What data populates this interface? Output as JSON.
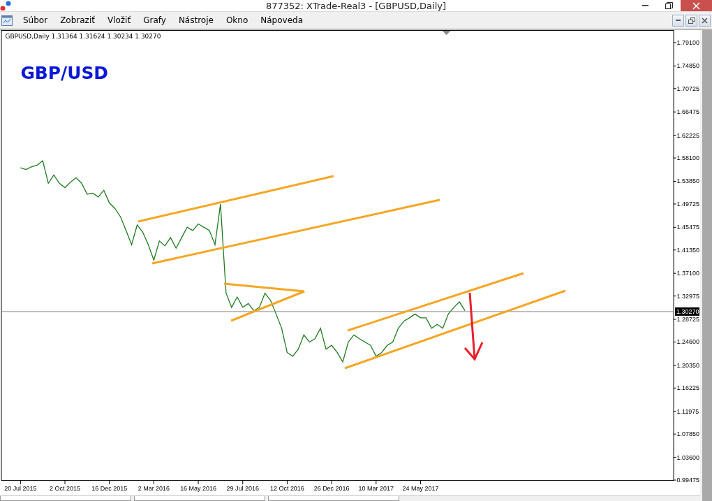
{
  "window": {
    "title": "877352: XTrade-Real3 - [GBPUSD,Daily]"
  },
  "menu": [
    {
      "label": "Súbor"
    },
    {
      "label": "Zobraziť"
    },
    {
      "label": "Vložiť"
    },
    {
      "label": "Grafy"
    },
    {
      "label": "Nástroje"
    },
    {
      "label": "Okno"
    },
    {
      "label": "Nápoveda"
    }
  ],
  "chart": {
    "header": "GBPUSD,Daily  1.31364 1.31624 1.30234 1.30270",
    "label": "GBP/USD",
    "current_price": "1.30270",
    "chart_data": {
      "type": "line",
      "ylim": [
        0.99475,
        1.81
      ],
      "categories": [
        null,
        null,
        null,
        "20 Jul 2015",
        null,
        null,
        null,
        null,
        null,
        null,
        null,
        "2 Oct 2015",
        null,
        null,
        null,
        null,
        null,
        null,
        null,
        "16 Dec 2015",
        null,
        null,
        null,
        null,
        null,
        null,
        null,
        "2 Mar 2016",
        null,
        null,
        null,
        null,
        null,
        null,
        null,
        "16 May 2016",
        null,
        null,
        null,
        null,
        null,
        null,
        null,
        "29 Jul 2016",
        null,
        null,
        null,
        null,
        null,
        null,
        null,
        "12 Oct 2016",
        null,
        null,
        null,
        null,
        null,
        null,
        null,
        "26 Dec 2016",
        null,
        null,
        null,
        null,
        null,
        null,
        null,
        "10 Mar 2017",
        null,
        null,
        null,
        null,
        null,
        null,
        null,
        "24 May 2017",
        null,
        null,
        null,
        null,
        null,
        null,
        null,
        null,
        null,
        null,
        null,
        null,
        null,
        null,
        null,
        null,
        null,
        null,
        null,
        null,
        null,
        null,
        null,
        null,
        null,
        null,
        null,
        null,
        null,
        null,
        null,
        null,
        null,
        null,
        null,
        null,
        null,
        null,
        null,
        null,
        null,
        null,
        null,
        null,
        null
      ],
      "series": [
        {
          "color": "#1f7a1f",
          "values": [
            null,
            null,
            null,
            1.563,
            1.56,
            1.565,
            1.568,
            1.576,
            1.535,
            1.55,
            1.535,
            1.527,
            1.537,
            1.545,
            1.535,
            1.515,
            1.517,
            1.51,
            1.522,
            1.499,
            1.489,
            1.474,
            1.449,
            1.423,
            1.459,
            1.446,
            1.423,
            1.395,
            1.43,
            1.421,
            1.436,
            1.417,
            1.436,
            1.455,
            1.449,
            1.461,
            1.455,
            1.449,
            1.423,
            1.497,
            1.335,
            1.309,
            1.328,
            1.309,
            1.316,
            1.303,
            1.309,
            1.335,
            1.322,
            1.297,
            1.271,
            1.227,
            1.22,
            1.233,
            1.259,
            1.246,
            1.252,
            1.271,
            1.233,
            1.24,
            1.227,
            1.21,
            1.246,
            1.259,
            1.252,
            1.246,
            1.24,
            1.22,
            1.227,
            1.24,
            1.246,
            1.271,
            1.284,
            1.29,
            1.297,
            1.29,
            1.29,
            1.271,
            1.278,
            1.271,
            1.297,
            1.309,
            1.319,
            1.303,
            null,
            null,
            null,
            null,
            null,
            null,
            null,
            null,
            null,
            null,
            null,
            null,
            null,
            null,
            null,
            null,
            null,
            null,
            null,
            null,
            null,
            null,
            null,
            null,
            null,
            null,
            null,
            null,
            null,
            null,
            null,
            null,
            null,
            null,
            null,
            null,
            null
          ]
        }
      ],
      "yticks": [
        {
          "value": 1.791,
          "label": "1.79100"
        },
        {
          "value": 1.7485,
          "label": "1.74850"
        },
        {
          "value": 1.70725,
          "label": "1.70725"
        },
        {
          "value": 1.66475,
          "label": "1.66475"
        },
        {
          "value": 1.62225,
          "label": "1.62225"
        },
        {
          "value": 1.581,
          "label": "1.58100"
        },
        {
          "value": 1.5385,
          "label": "1.53850"
        },
        {
          "value": 1.49725,
          "label": "1.49725"
        },
        {
          "value": 1.45475,
          "label": "1.45475"
        },
        {
          "value": 1.4135,
          "label": "1.41350"
        },
        {
          "value": 1.371,
          "label": "1.37100"
        },
        {
          "value": 1.32975,
          "label": "1.32975"
        },
        {
          "value": 1.28725,
          "label": "1.28725"
        },
        {
          "value": 1.246,
          "label": "1.24600"
        },
        {
          "value": 1.2035,
          "label": "1.20350"
        },
        {
          "value": 1.16225,
          "label": "1.16225"
        },
        {
          "value": 1.11975,
          "label": "1.11975"
        },
        {
          "value": 1.0785,
          "label": "1.07850"
        },
        {
          "value": 1.036,
          "label": "1.03600"
        },
        {
          "value": 0.99475,
          "label": "0.99475"
        }
      ]
    }
  }
}
